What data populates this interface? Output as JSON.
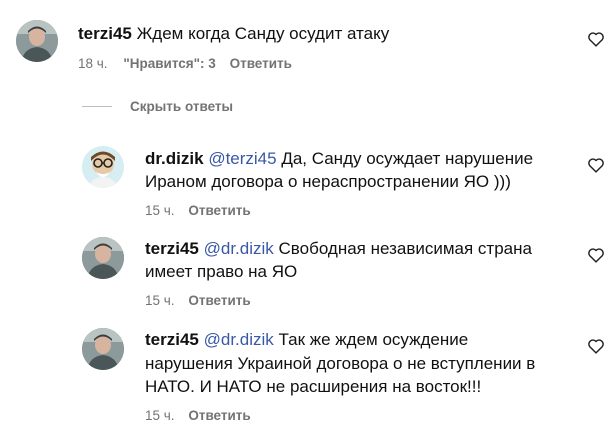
{
  "comments": [
    {
      "username": "terzi45",
      "mention": "",
      "text": "Ждем когда Санду осудит атаку",
      "lines": [
        "Ждем когда Санду осудит атаку"
      ],
      "time": "18 ч.",
      "likes": "\"Нравится\": 3",
      "reply_label": "Ответить",
      "avatar_icon": "user-photo-avatar"
    },
    {
      "username": "dr.dizik",
      "mention": "@terzi45",
      "text_line1": "Да, Санду осуждает нарушение",
      "text_line2": "Ираном договора о нераспространении ЯО )))",
      "time": "15 ч.",
      "reply_label": "Ответить",
      "avatar_icon": "cartoon-avatar"
    },
    {
      "username": "terzi45",
      "mention": "@dr.dizik",
      "text_line1": "Свободная независимая страна",
      "text_line2": "имеет право на ЯО",
      "time": "15 ч.",
      "reply_label": "Ответить",
      "avatar_icon": "user-photo-avatar"
    },
    {
      "username": "terzi45",
      "mention": "@dr.dizik",
      "text_line1": "Так же ждем осуждение",
      "text_line2": "нарушения Украиной договора о не вступлении в",
      "text_line3": "НАТО. И НАТО не расширения на восток!!!",
      "time": "15 ч.",
      "reply_label": "Ответить",
      "avatar_icon": "user-photo-avatar"
    }
  ],
  "hide_replies_label": "Скрыть ответы",
  "colors": {
    "text": "#111111",
    "meta": "#737373",
    "mention": "#3a58a8",
    "divider": "#bdbdbd"
  }
}
